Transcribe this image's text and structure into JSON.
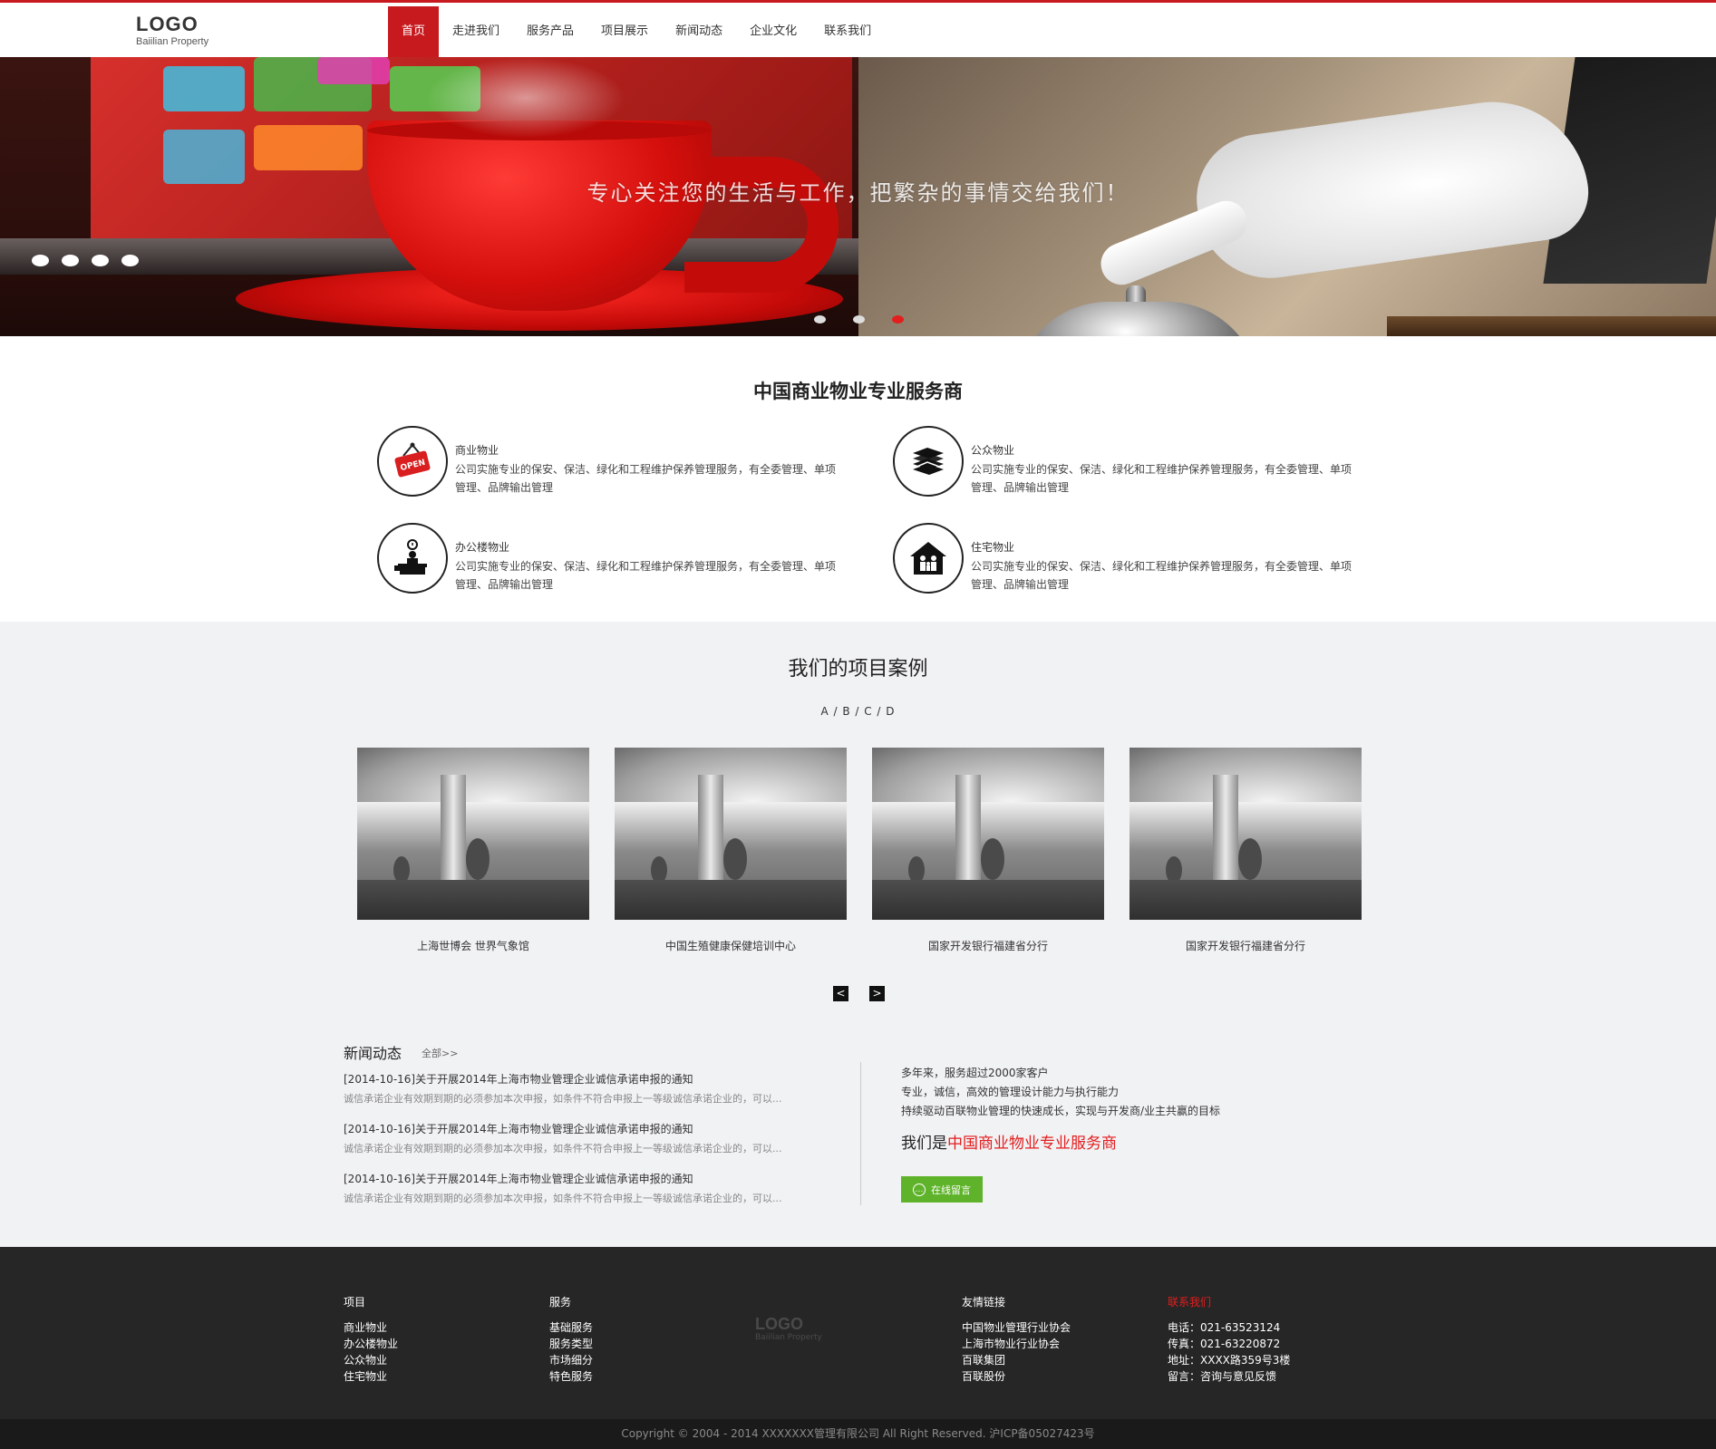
{
  "header": {
    "logo_main": "LOGO",
    "logo_sub": "Baiilian Property",
    "nav": [
      "首页",
      "走进我们",
      "服务产品",
      "项目展示",
      "新闻动态",
      "企业文化",
      "联系我们"
    ],
    "active_nav": "首页"
  },
  "banner": {
    "slogan": "专心关注您的生活与工作，把繁杂的事情交给我们！",
    "left_dots": 4,
    "bottom_dots": 3,
    "active_bottom_dot": 3,
    "cup_icon": "coffee-cup",
    "bell_icon": "service-bell"
  },
  "services": {
    "title": "中国商业物业专业服务商",
    "items": [
      {
        "name": "商业物业",
        "icon": "open-sign-icon",
        "desc": "公司实施专业的保安、保洁、绿化和工程维护保养管理服务，有全委管理、单项管理、品牌输出管理"
      },
      {
        "name": "公众物业",
        "icon": "documents-icon",
        "desc": "公司实施专业的保安、保洁、绿化和工程维护保养管理服务，有全委管理、单项管理、品牌输出管理"
      },
      {
        "name": "办公楼物业",
        "icon": "office-desk-icon",
        "desc": "公司实施专业的保安、保洁、绿化和工程维护保养管理服务，有全委管理、单项管理、品牌输出管理"
      },
      {
        "name": "住宅物业",
        "icon": "family-house-icon",
        "desc": "公司实施专业的保安、保洁、绿化和工程维护保养管理服务，有全委管理、单项管理、品牌输出管理"
      }
    ]
  },
  "projects": {
    "title": "我们的项目案例",
    "filter": "A / B / C / D",
    "cards": [
      {
        "label": "上海世博会 世界气象馆"
      },
      {
        "label": "中国生殖健康保健培训中心"
      },
      {
        "label": "国家开发银行福建省分行"
      },
      {
        "label": "国家开发银行福建省分行"
      }
    ],
    "prev": "<",
    "next": ">"
  },
  "news": {
    "title": "新闻动态",
    "more": "全部>>",
    "items": [
      {
        "head": "[2014-10-16]关于开展2014年上海市物业管理企业诚信承诺申报的通知",
        "summary": "诚信承诺企业有效期到期的必须参加本次申报，如条件不符合申报上一等级诚信承诺企业的，可以..."
      },
      {
        "head": "[2014-10-16]关于开展2014年上海市物业管理企业诚信承诺申报的通知",
        "summary": "诚信承诺企业有效期到期的必须参加本次申报，如条件不符合申报上一等级诚信承诺企业的，可以..."
      },
      {
        "head": "[2014-10-16]关于开展2014年上海市物业管理企业诚信承诺申报的通知",
        "summary": "诚信承诺企业有效期到期的必须参加本次申报，如条件不符合申报上一等级诚信承诺企业的，可以..."
      }
    ]
  },
  "about": {
    "lines": [
      "多年来，服务超过2000家客户",
      "专业，诚信，高效的管理设计能力与执行能力",
      "持续驱动百联物业管理的快速成长，实现与开发商/业主共赢的目标"
    ],
    "slogan_prefix": "我们是",
    "slogan_highlight": "中国商业物业专业服务商",
    "button": "在线留言"
  },
  "footer": {
    "col1": {
      "title": "项目",
      "items": [
        "商业物业",
        "办公楼物业",
        "公众物业",
        "住宅物业"
      ]
    },
    "col2": {
      "title": "服务",
      "items": [
        "基础服务",
        "服务类型",
        "市场细分",
        "特色服务"
      ]
    },
    "logo_main": "LOGO",
    "logo_sub": "Baiilian Property",
    "col3": {
      "title": "友情链接",
      "items": [
        "中国物业管理行业协会",
        "上海市物业行业协会",
        "百联集团",
        "百联股份"
      ]
    },
    "col4": {
      "title": "联系我们",
      "items": [
        "电话：021-63523124",
        "传真：021-63220872",
        "地址：XXXX路359号3楼",
        "留言：咨询与意见反馈"
      ]
    },
    "copyright": "Copyright © 2004 - 2014 XXXXXXX管理有限公司 All Right Reserved. 沪ICP备05027423号"
  },
  "colors": {
    "accent": "#c71a1f",
    "green": "#5fb32a",
    "footer_bg": "#262626"
  }
}
